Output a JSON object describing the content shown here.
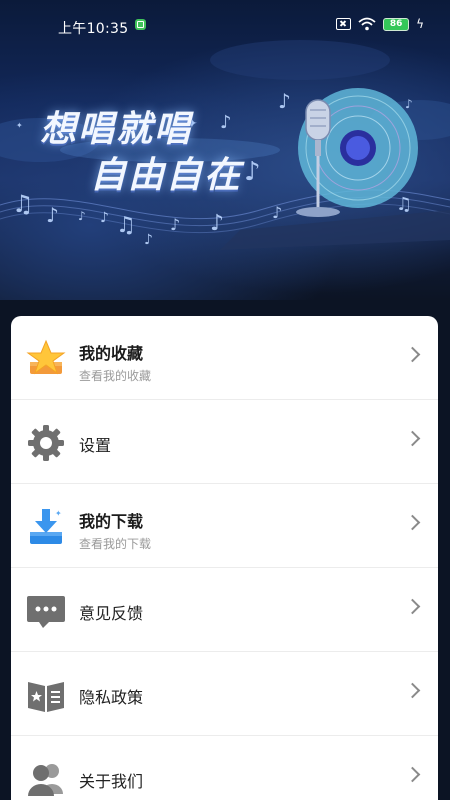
{
  "status_bar": {
    "time": "上午10:35",
    "battery": "86"
  },
  "banner": {
    "title_line1": "想唱就唱",
    "title_line2": "自由自在"
  },
  "menu": [
    {
      "id": "favorites",
      "title": "我的收藏",
      "subtitle": "查看我的收藏",
      "icon": "star-icon"
    },
    {
      "id": "settings",
      "title": "设置",
      "subtitle": "",
      "icon": "gear-icon"
    },
    {
      "id": "downloads",
      "title": "我的下载",
      "subtitle": "查看我的下载",
      "icon": "download-icon"
    },
    {
      "id": "feedback",
      "title": "意见反馈",
      "subtitle": "",
      "icon": "chat-icon"
    },
    {
      "id": "privacy",
      "title": "隐私政策",
      "subtitle": "",
      "icon": "book-icon"
    },
    {
      "id": "about",
      "title": "关于我们",
      "subtitle": "",
      "icon": "users-icon"
    }
  ]
}
